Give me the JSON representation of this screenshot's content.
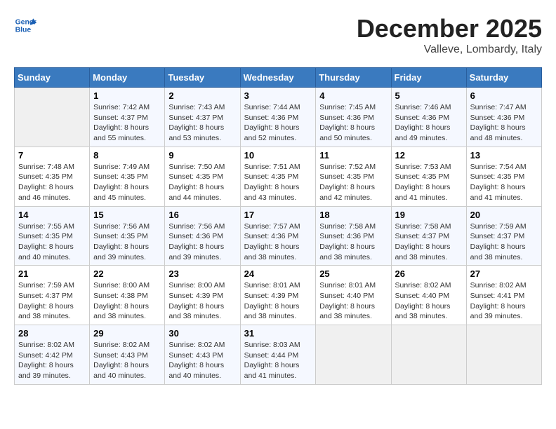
{
  "header": {
    "logo_line1": "General",
    "logo_line2": "Blue",
    "month": "December 2025",
    "location": "Valleve, Lombardy, Italy"
  },
  "weekdays": [
    "Sunday",
    "Monday",
    "Tuesday",
    "Wednesday",
    "Thursday",
    "Friday",
    "Saturday"
  ],
  "weeks": [
    [
      {
        "day": "",
        "sunrise": "",
        "sunset": "",
        "daylight": ""
      },
      {
        "day": "1",
        "sunrise": "Sunrise: 7:42 AM",
        "sunset": "Sunset: 4:37 PM",
        "daylight": "Daylight: 8 hours and 55 minutes."
      },
      {
        "day": "2",
        "sunrise": "Sunrise: 7:43 AM",
        "sunset": "Sunset: 4:37 PM",
        "daylight": "Daylight: 8 hours and 53 minutes."
      },
      {
        "day": "3",
        "sunrise": "Sunrise: 7:44 AM",
        "sunset": "Sunset: 4:36 PM",
        "daylight": "Daylight: 8 hours and 52 minutes."
      },
      {
        "day": "4",
        "sunrise": "Sunrise: 7:45 AM",
        "sunset": "Sunset: 4:36 PM",
        "daylight": "Daylight: 8 hours and 50 minutes."
      },
      {
        "day": "5",
        "sunrise": "Sunrise: 7:46 AM",
        "sunset": "Sunset: 4:36 PM",
        "daylight": "Daylight: 8 hours and 49 minutes."
      },
      {
        "day": "6",
        "sunrise": "Sunrise: 7:47 AM",
        "sunset": "Sunset: 4:36 PM",
        "daylight": "Daylight: 8 hours and 48 minutes."
      }
    ],
    [
      {
        "day": "7",
        "sunrise": "Sunrise: 7:48 AM",
        "sunset": "Sunset: 4:35 PM",
        "daylight": "Daylight: 8 hours and 46 minutes."
      },
      {
        "day": "8",
        "sunrise": "Sunrise: 7:49 AM",
        "sunset": "Sunset: 4:35 PM",
        "daylight": "Daylight: 8 hours and 45 minutes."
      },
      {
        "day": "9",
        "sunrise": "Sunrise: 7:50 AM",
        "sunset": "Sunset: 4:35 PM",
        "daylight": "Daylight: 8 hours and 44 minutes."
      },
      {
        "day": "10",
        "sunrise": "Sunrise: 7:51 AM",
        "sunset": "Sunset: 4:35 PM",
        "daylight": "Daylight: 8 hours and 43 minutes."
      },
      {
        "day": "11",
        "sunrise": "Sunrise: 7:52 AM",
        "sunset": "Sunset: 4:35 PM",
        "daylight": "Daylight: 8 hours and 42 minutes."
      },
      {
        "day": "12",
        "sunrise": "Sunrise: 7:53 AM",
        "sunset": "Sunset: 4:35 PM",
        "daylight": "Daylight: 8 hours and 41 minutes."
      },
      {
        "day": "13",
        "sunrise": "Sunrise: 7:54 AM",
        "sunset": "Sunset: 4:35 PM",
        "daylight": "Daylight: 8 hours and 41 minutes."
      }
    ],
    [
      {
        "day": "14",
        "sunrise": "Sunrise: 7:55 AM",
        "sunset": "Sunset: 4:35 PM",
        "daylight": "Daylight: 8 hours and 40 minutes."
      },
      {
        "day": "15",
        "sunrise": "Sunrise: 7:56 AM",
        "sunset": "Sunset: 4:35 PM",
        "daylight": "Daylight: 8 hours and 39 minutes."
      },
      {
        "day": "16",
        "sunrise": "Sunrise: 7:56 AM",
        "sunset": "Sunset: 4:36 PM",
        "daylight": "Daylight: 8 hours and 39 minutes."
      },
      {
        "day": "17",
        "sunrise": "Sunrise: 7:57 AM",
        "sunset": "Sunset: 4:36 PM",
        "daylight": "Daylight: 8 hours and 38 minutes."
      },
      {
        "day": "18",
        "sunrise": "Sunrise: 7:58 AM",
        "sunset": "Sunset: 4:36 PM",
        "daylight": "Daylight: 8 hours and 38 minutes."
      },
      {
        "day": "19",
        "sunrise": "Sunrise: 7:58 AM",
        "sunset": "Sunset: 4:37 PM",
        "daylight": "Daylight: 8 hours and 38 minutes."
      },
      {
        "day": "20",
        "sunrise": "Sunrise: 7:59 AM",
        "sunset": "Sunset: 4:37 PM",
        "daylight": "Daylight: 8 hours and 38 minutes."
      }
    ],
    [
      {
        "day": "21",
        "sunrise": "Sunrise: 7:59 AM",
        "sunset": "Sunset: 4:37 PM",
        "daylight": "Daylight: 8 hours and 38 minutes."
      },
      {
        "day": "22",
        "sunrise": "Sunrise: 8:00 AM",
        "sunset": "Sunset: 4:38 PM",
        "daylight": "Daylight: 8 hours and 38 minutes."
      },
      {
        "day": "23",
        "sunrise": "Sunrise: 8:00 AM",
        "sunset": "Sunset: 4:39 PM",
        "daylight": "Daylight: 8 hours and 38 minutes."
      },
      {
        "day": "24",
        "sunrise": "Sunrise: 8:01 AM",
        "sunset": "Sunset: 4:39 PM",
        "daylight": "Daylight: 8 hours and 38 minutes."
      },
      {
        "day": "25",
        "sunrise": "Sunrise: 8:01 AM",
        "sunset": "Sunset: 4:40 PM",
        "daylight": "Daylight: 8 hours and 38 minutes."
      },
      {
        "day": "26",
        "sunrise": "Sunrise: 8:02 AM",
        "sunset": "Sunset: 4:40 PM",
        "daylight": "Daylight: 8 hours and 38 minutes."
      },
      {
        "day": "27",
        "sunrise": "Sunrise: 8:02 AM",
        "sunset": "Sunset: 4:41 PM",
        "daylight": "Daylight: 8 hours and 39 minutes."
      }
    ],
    [
      {
        "day": "28",
        "sunrise": "Sunrise: 8:02 AM",
        "sunset": "Sunset: 4:42 PM",
        "daylight": "Daylight: 8 hours and 39 minutes."
      },
      {
        "day": "29",
        "sunrise": "Sunrise: 8:02 AM",
        "sunset": "Sunset: 4:43 PM",
        "daylight": "Daylight: 8 hours and 40 minutes."
      },
      {
        "day": "30",
        "sunrise": "Sunrise: 8:02 AM",
        "sunset": "Sunset: 4:43 PM",
        "daylight": "Daylight: 8 hours and 40 minutes."
      },
      {
        "day": "31",
        "sunrise": "Sunrise: 8:03 AM",
        "sunset": "Sunset: 4:44 PM",
        "daylight": "Daylight: 8 hours and 41 minutes."
      },
      {
        "day": "",
        "sunrise": "",
        "sunset": "",
        "daylight": ""
      },
      {
        "day": "",
        "sunrise": "",
        "sunset": "",
        "daylight": ""
      },
      {
        "day": "",
        "sunrise": "",
        "sunset": "",
        "daylight": ""
      }
    ]
  ]
}
